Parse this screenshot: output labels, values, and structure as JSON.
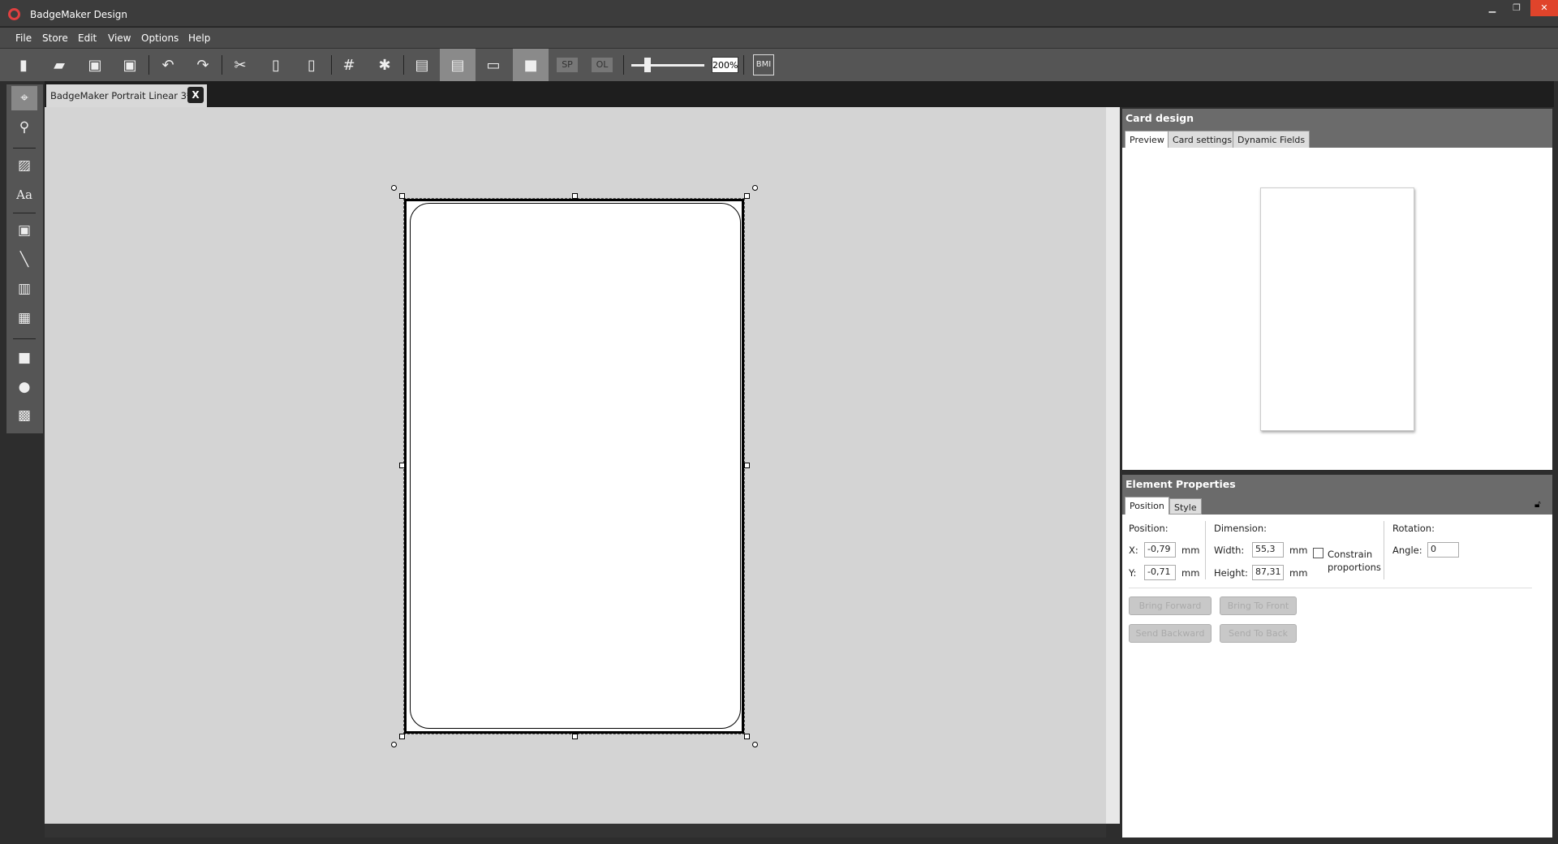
{
  "window": {
    "title": "BadgeMaker Design",
    "minimize": "▁",
    "restore": "❐",
    "close": "✕"
  },
  "menu": [
    "File",
    "Store",
    "Edit",
    "View",
    "Options",
    "Help"
  ],
  "toolbar": {
    "icons": [
      "new-icon",
      "open-icon",
      "save-icon",
      "save-as-icon",
      "undo-icon",
      "redo-icon",
      "cut-icon",
      "copy-icon",
      "paste-icon",
      "grid-icon",
      "settings-icon",
      "layers-icon",
      "layout-icon",
      "align-icon",
      "card-icon"
    ],
    "sp_label": "SP",
    "ol_label": "OL",
    "zoom": "200%",
    "zoom_slider_fraction": 0.2,
    "bmi_label": "BMI"
  },
  "document_tab": {
    "title": "BadgeMaker Portrait Linear 3*",
    "close": "X"
  },
  "tools": [
    "select-icon",
    "zoom-icon",
    "image-icon",
    "text-icon",
    "photo-icon",
    "line-icon",
    "barcode-icon",
    "qrcode-icon",
    "rectangle-icon",
    "ellipse-icon",
    "background-icon"
  ],
  "card_design": {
    "title": "Card design",
    "tabs": [
      "Preview",
      "Card settings",
      "Dynamic Fields"
    ]
  },
  "element_properties": {
    "title": "Element Properties",
    "tabs": [
      "Position",
      "Style"
    ],
    "position_label": "Position:",
    "x_label": "X:",
    "x": "-0,79",
    "y_label": "Y:",
    "y": "-0,71",
    "unit": "mm",
    "dimension_label": "Dimension:",
    "width_label": "Width:",
    "width": "55,3",
    "height_label": "Height:",
    "height": "87,31",
    "constrain_label": "Constrain proportions",
    "constrain_checked": false,
    "rotation_label": "Rotation:",
    "angle_label": "Angle:",
    "angle": "0",
    "buttons": [
      "Bring Forward",
      "Bring To Front",
      "Send Backward",
      "Send To Back"
    ]
  }
}
